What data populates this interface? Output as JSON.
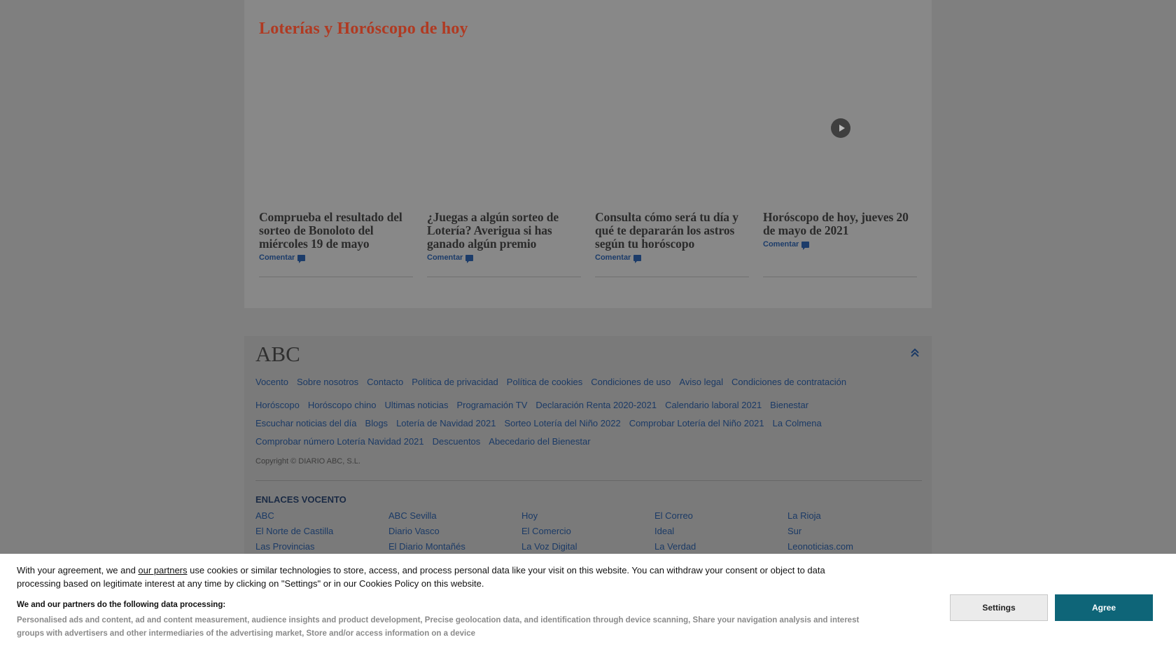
{
  "section": {
    "title": "Loterías y Horóscopo de hoy",
    "cards": [
      {
        "headline": "Comprueba el resultado del sorteo de Bonoloto del miércoles 19 de mayo",
        "comment": "Comentar"
      },
      {
        "headline": "¿Juegas a algún sorteo de Lotería? Averigua si has ganado algún premio",
        "comment": "Comentar"
      },
      {
        "headline": "Consulta cómo será tu día y qué te depararán los astros según tu horóscopo",
        "comment": "Comentar"
      },
      {
        "headline": "Horóscopo de hoy, jueves 20 de mayo de 2021",
        "comment": "Comentar"
      }
    ]
  },
  "footer": {
    "logo": "ABC",
    "row1": [
      "Vocento",
      "Sobre nosotros",
      "Contacto",
      "Política de privacidad",
      "Política de cookies",
      "Condiciones de uso",
      "Aviso legal",
      "Condiciones de contratación"
    ],
    "row2": [
      "Horóscopo",
      "Horóscopo chino",
      "Ultimas noticias",
      "Programación TV",
      "Declaración Renta 2020-2021",
      "Calendario laboral 2021",
      "Bienestar"
    ],
    "row3": [
      "Escuchar noticias del día",
      "Blogs",
      "Lotería de Navidad 2021",
      "Sorteo Lotería del Niño 2022",
      "Comprobar Lotería del Niño 2021",
      "La Colmena"
    ],
    "row4": [
      "Comprobar número Lotería Navidad 2021",
      "Descuentos",
      "Abecedario del Bienestar"
    ],
    "copyright": "Copyright © DIARIO ABC, S.L.",
    "enlaces_title": "ENLACES VOCENTO",
    "enlaces": [
      "ABC",
      "ABC Sevilla",
      "Hoy",
      "El Correo",
      "La Rioja",
      "El Norte de Castilla",
      "Diario Vasco",
      "El Comercio",
      "Ideal",
      "Sur",
      "Las Provincias",
      "El Diario Montañés",
      "La Voz Digital",
      "La Verdad",
      "Leonoticias.com"
    ]
  },
  "cookie": {
    "text_before": "With your agreement, we and ",
    "partners_link": "our partners",
    "text_after": " use cookies or similar technologies to store, access, and process personal data like your visit on this website. You can withdraw your consent or object to data processing based on legitimate interest at any time by clicking on \"Settings\" or in our Cookies Policy on this website.",
    "subtitle": "We and our partners do the following data processing:",
    "purposes": "Personalised ads and content, ad and content measurement, audience insights and product development, Precise geolocation data, and identification through device scanning, Share your navigation analysis and interest groups with advertisers and other intermediaries of the advertising market, Store and/or access information on a device",
    "settings_label": "Settings",
    "agree_label": "Agree",
    "agree_color": "#0e6578"
  }
}
